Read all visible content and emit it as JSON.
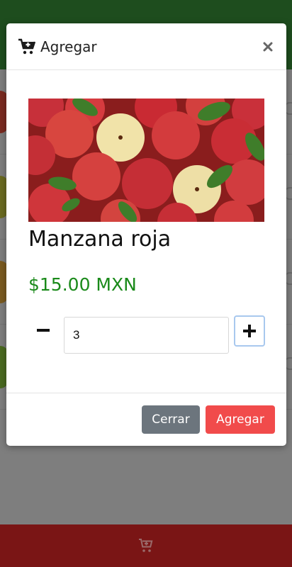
{
  "modal": {
    "title": "Agregar",
    "title_icon": "cart-plus-icon",
    "close_icon": "close-icon",
    "product": {
      "name": "Manzana roja",
      "price": "$15.00 MXN",
      "image": "apples-photo"
    },
    "quantity": {
      "value": "3",
      "minus_icon": "minus-icon",
      "plus_icon": "plus-icon"
    },
    "buttons": {
      "close_label": "Cerrar",
      "add_label": "Agregar"
    }
  },
  "footer": {
    "cart_icon": "cart-plus-icon"
  },
  "colors": {
    "header_green": "#1e4d1e",
    "footer_red": "#7a1515",
    "price_green": "#1a8a1a",
    "add_button_red": "#f14b4b",
    "close_button_gray": "#6c757d"
  }
}
